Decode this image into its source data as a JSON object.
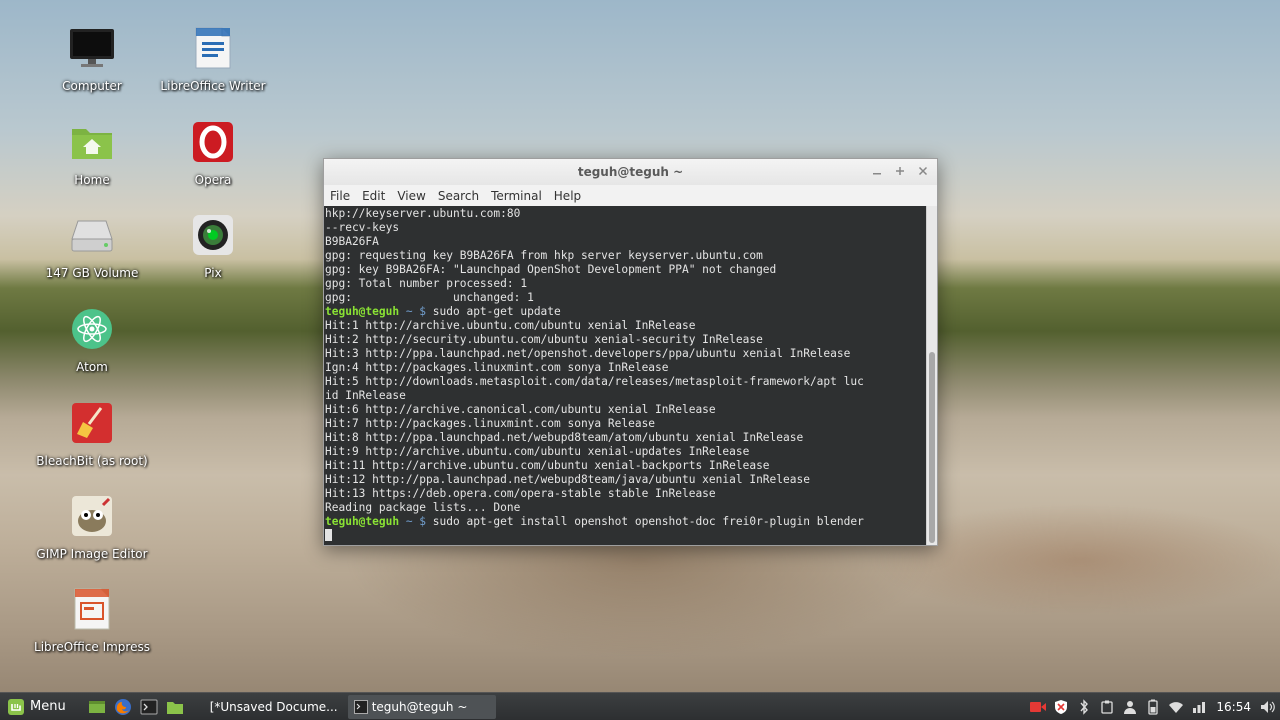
{
  "desktop": {
    "icons": [
      {
        "label": "Computer",
        "icon": "monitor-icon"
      },
      {
        "label": "LibreOffice Writer",
        "icon": "writer-icon"
      },
      {
        "label": "Home",
        "icon": "home-folder-icon"
      },
      {
        "label": "Opera",
        "icon": "opera-icon"
      },
      {
        "label": "147 GB Volume",
        "icon": "drive-icon"
      },
      {
        "label": "Pix",
        "icon": "camera-icon"
      },
      {
        "label": "Atom",
        "icon": "atom-icon"
      },
      {
        "label": "BleachBit (as root)",
        "icon": "broom-icon"
      },
      {
        "label": "GIMP Image Editor",
        "icon": "gimp-icon"
      },
      {
        "label": "LibreOffice Impress",
        "icon": "impress-icon"
      }
    ]
  },
  "terminal": {
    "title": "teguh@teguh ~",
    "menu": [
      "File",
      "Edit",
      "View",
      "Search",
      "Terminal",
      "Help"
    ],
    "lines": [
      "hkp://keyserver.ubuntu.com:80",
      "--recv-keys",
      "B9BA26FA",
      "gpg: requesting key B9BA26FA from hkp server keyserver.ubuntu.com",
      "gpg: key B9BA26FA: \"Launchpad OpenShot Development PPA\" not changed",
      "gpg: Total number processed: 1",
      "gpg:               unchanged: 1"
    ],
    "prompt_user": "teguh@teguh",
    "prompt_sym": " ~ $ ",
    "cmd1": "sudo apt-get update",
    "lines2": [
      "Hit:1 http://archive.ubuntu.com/ubuntu xenial InRelease",
      "Hit:2 http://security.ubuntu.com/ubuntu xenial-security InRelease",
      "Hit:3 http://ppa.launchpad.net/openshot.developers/ppa/ubuntu xenial InRelease",
      "Ign:4 http://packages.linuxmint.com sonya InRelease",
      "Hit:5 http://downloads.metasploit.com/data/releases/metasploit-framework/apt luc",
      "id InRelease",
      "Hit:6 http://archive.canonical.com/ubuntu xenial InRelease",
      "Hit:7 http://packages.linuxmint.com sonya Release",
      "Hit:8 http://ppa.launchpad.net/webupd8team/atom/ubuntu xenial InRelease",
      "Hit:9 http://archive.ubuntu.com/ubuntu xenial-updates InRelease",
      "Hit:11 http://archive.ubuntu.com/ubuntu xenial-backports InRelease",
      "Hit:12 http://ppa.launchpad.net/webupd8team/java/ubuntu xenial InRelease",
      "Hit:13 https://deb.opera.com/opera-stable stable InRelease",
      "Reading package lists... Done"
    ],
    "cmd2": "sudo apt-get install openshot openshot-doc frei0r-plugin blender"
  },
  "taskbar": {
    "menu_label": "Menu",
    "tasks": [
      {
        "label": "[*Unsaved Docume..."
      },
      {
        "label": "teguh@teguh ~"
      }
    ],
    "clock": "16:54"
  },
  "colors": {
    "terminal_bg": "#2e3031",
    "prompt_user": "#8ae234",
    "prompt_symbol": "#729fcf",
    "taskbar_bg": "#2d2f31"
  }
}
